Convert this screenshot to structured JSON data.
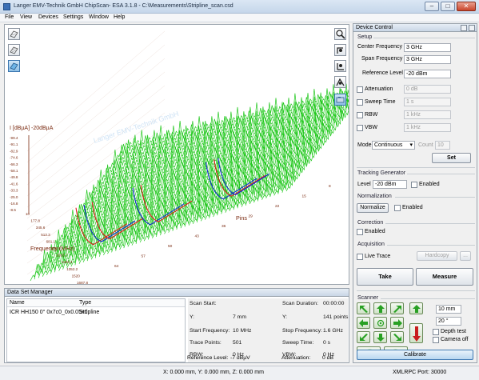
{
  "window": {
    "title": "Langer EMV-Technik GmbH ChipScan- ESA 3.1.8 - C:\\Measurements\\Stripline_scan.csd",
    "minimize": "–",
    "maximize": "□",
    "close": "✕"
  },
  "menu": {
    "items": [
      "File",
      "View",
      "Devices",
      "Settings",
      "Window",
      "Help"
    ]
  },
  "plot": {
    "y_axis_title": "I [dBµA] -20dBµA",
    "y_ticks": [
      "-99.4",
      "-91.1",
      "-82.9",
      "-74.6",
      "-66.3",
      "-58.1",
      "-49.8",
      "-41.6",
      "-33.3",
      "-25.0",
      "-16.8",
      "-8.5"
    ],
    "freq_ticks": [
      "10",
      "177.8",
      "345.6",
      "513.3",
      "681.1",
      "848.9",
      "1016.7",
      "1184.4",
      "1352.2",
      "1520",
      "1687.8",
      "1855.6"
    ],
    "freq_axis_title": "Frequency (MHz)",
    "pin_ticks": [
      "64",
      "57",
      "50",
      "43",
      "36",
      "29",
      "22",
      "15",
      "8",
      "1"
    ],
    "pins_axis_title": "Pins",
    "watermark": "Langer EMV-Technik GmbH",
    "tools_left": [
      "plot-view-icon",
      "waterfall-view-icon",
      "surface-view-icon"
    ],
    "tools_right": [
      "zoom-icon",
      "rotate-icon",
      "pan-icon",
      "move-icon",
      "camera-icon"
    ],
    "colors": {
      "trace_green": "#22c81e",
      "trace_red": "#e0191d",
      "trace_blue": "#1625d8",
      "axis_brown": "#7a2a10"
    }
  },
  "device_control": {
    "header": "Device Control",
    "setup_title": "Setup",
    "center_frequency": {
      "label": "Center Frequency",
      "value": "3 GHz"
    },
    "span_frequency": {
      "label": "Span Frequency",
      "value": "3 GHz"
    },
    "reference_level": {
      "label": "Reference Level",
      "value": "-20 dBm"
    },
    "attenuation": {
      "label": "Attenuation",
      "value": "0 dB"
    },
    "sweep_time": {
      "label": "Sweep Time",
      "value": "1 s"
    },
    "rbw": {
      "label": "RBW",
      "value": "1 kHz"
    },
    "vbw": {
      "label": "VBW",
      "value": "1 kHz"
    },
    "mode": {
      "label": "Mode",
      "value": "Continuous",
      "count_label": "Count",
      "count_value": "10"
    },
    "set_button": "Set",
    "tracking_title": "Tracking Generator",
    "tracking_level_label": "Level",
    "tracking_level_value": "-20 dBm",
    "tracking_enabled": "Enabled",
    "normalization_title": "Normalization",
    "normalize_button": "Normalize",
    "normalization_enabled": "Enabled",
    "correction_title": "Correction",
    "correction_enabled": "Enabled",
    "acquisition_title": "Acquisition",
    "live_trace": "Live Trace",
    "hardcopy_button": "Hardcopy",
    "more_button": "...",
    "take_button": "Take",
    "measure_button": "Measure",
    "scanner_title": "Scanner",
    "step_value": "10 mm",
    "angle_value": "20 °",
    "depth_test": "Depth test",
    "camera_off": "Camera off",
    "calibrate_button": "Calibrate"
  },
  "data_set_manager": {
    "title": "Data Set Manager",
    "columns": [
      "Name",
      "Type"
    ],
    "rows": [
      {
        "name": "ICR HH150 0° 0x7c0_0x0.05x0",
        "type": "Stripline"
      }
    ]
  },
  "scan_info": {
    "scan_start_label": "Scan Start:",
    "scan_start_value": "",
    "scan_duration_label": "Scan Duration:",
    "scan_duration_value": "00:00:00",
    "y_label": "Y:",
    "y_value": "7 mm",
    "y2_label": "Y:",
    "y2_value": "141 points",
    "start_freq_label": "Start Frequency:",
    "start_freq_value": "10 MHz",
    "stop_freq_label": "Stop Frequency:",
    "stop_freq_value": "1.6 GHz",
    "trace_points_label": "Trace Points:",
    "trace_points_value": "501",
    "sweep_time_label": "Sweep Time:",
    "sweep_time_value": "0 s",
    "rbw_label": "RBW:",
    "rbw_value": "0 Hz",
    "vbw_label": "VBW:",
    "vbw_value": "0 Hz",
    "ref_level_label": "Reference Level:",
    "ref_level_value": "-7 dBµV",
    "attenuation_label": "Attenuation:",
    "attenuation_value": "0 dB"
  },
  "status": {
    "coords": "X: 0.000 mm, Y: 0.000 mm, Z: 0.000 mm",
    "xmlrpc": "XMLRPC Port: 30000"
  }
}
